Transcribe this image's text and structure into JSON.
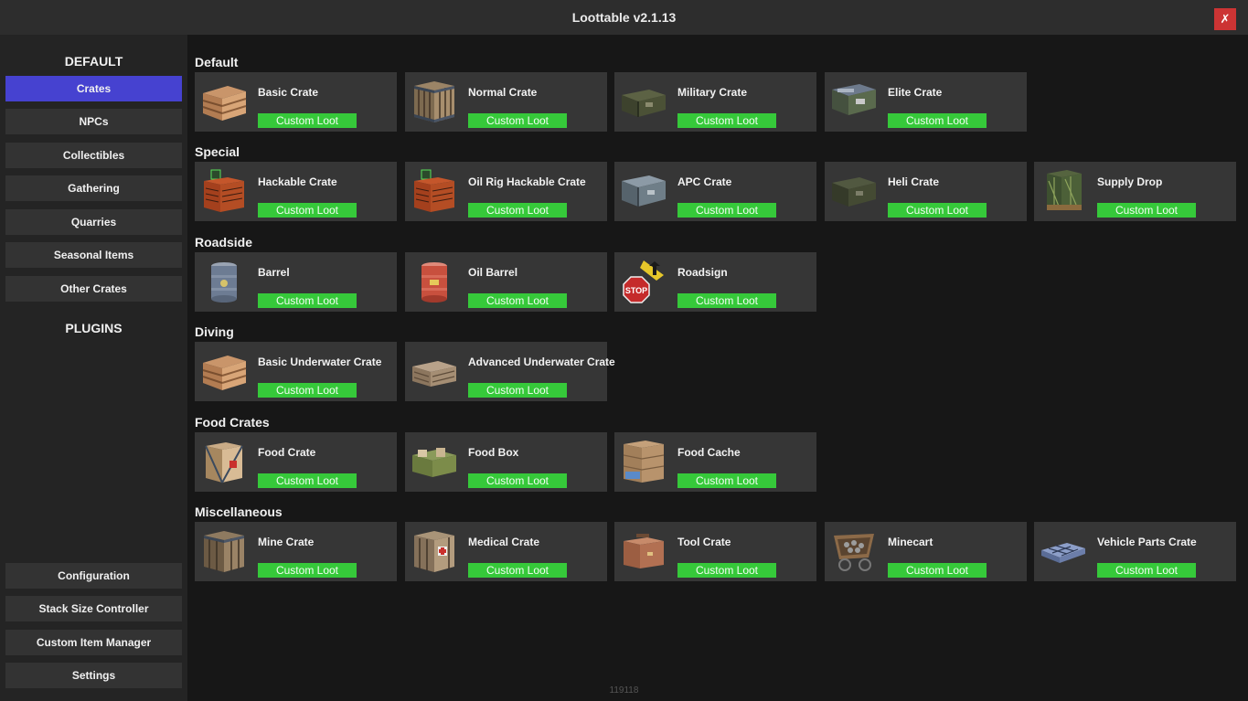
{
  "window": {
    "title": "Loottable v2.1.13",
    "close_label": "✗"
  },
  "sidebar": {
    "default_heading": "DEFAULT",
    "default_items": [
      "Crates",
      "NPCs",
      "Collectibles",
      "Gathering",
      "Quarries",
      "Seasonal Items",
      "Other Crates"
    ],
    "active_item": "Crates",
    "plugins_heading": "PLUGINS",
    "bottom_items": [
      "Configuration",
      "Stack Size Controller",
      "Custom Item Manager",
      "Settings"
    ]
  },
  "accent_colors": {
    "active": "#4642d0",
    "loot_button": "#36c93a",
    "close": "#cc3434"
  },
  "button_label": "Custom Loot",
  "sections": [
    {
      "title": "Default",
      "items": [
        {
          "name": "Basic Crate",
          "icon": "wooden-crate-icon"
        },
        {
          "name": "Normal Crate",
          "icon": "large-crate-icon"
        },
        {
          "name": "Military Crate",
          "icon": "military-crate-icon"
        },
        {
          "name": "Elite Crate",
          "icon": "elite-crate-icon"
        }
      ]
    },
    {
      "title": "Special",
      "items": [
        {
          "name": "Hackable Crate",
          "icon": "hackable-crate-icon"
        },
        {
          "name": "Oil Rig Hackable Crate",
          "icon": "hackable-crate-icon"
        },
        {
          "name": "APC Crate",
          "icon": "apc-crate-icon"
        },
        {
          "name": "Heli Crate",
          "icon": "heli-crate-icon"
        },
        {
          "name": "Supply Drop",
          "icon": "supply-drop-icon"
        }
      ]
    },
    {
      "title": "Roadside",
      "items": [
        {
          "name": "Barrel",
          "icon": "barrel-icon"
        },
        {
          "name": "Oil Barrel",
          "icon": "oil-barrel-icon"
        },
        {
          "name": "Roadsign",
          "icon": "roadsign-icon"
        }
      ]
    },
    {
      "title": "Diving",
      "items": [
        {
          "name": "Basic Underwater Crate",
          "icon": "wooden-crate-icon"
        },
        {
          "name": "Advanced Underwater Crate",
          "icon": "underwater-crate-icon"
        }
      ]
    },
    {
      "title": "Food Crates",
      "items": [
        {
          "name": "Food Crate",
          "icon": "food-crate-icon"
        },
        {
          "name": "Food Box",
          "icon": "food-box-icon"
        },
        {
          "name": "Food Cache",
          "icon": "food-cache-icon"
        }
      ]
    },
    {
      "title": "Miscellaneous",
      "items": [
        {
          "name": "Mine Crate",
          "icon": "mine-crate-icon"
        },
        {
          "name": "Medical Crate",
          "icon": "medical-crate-icon"
        },
        {
          "name": "Tool Crate",
          "icon": "tool-crate-icon"
        },
        {
          "name": "Minecart",
          "icon": "minecart-icon"
        },
        {
          "name": "Vehicle Parts Crate",
          "icon": "vehicle-parts-crate-icon"
        }
      ]
    }
  ],
  "footer_id": "119118"
}
